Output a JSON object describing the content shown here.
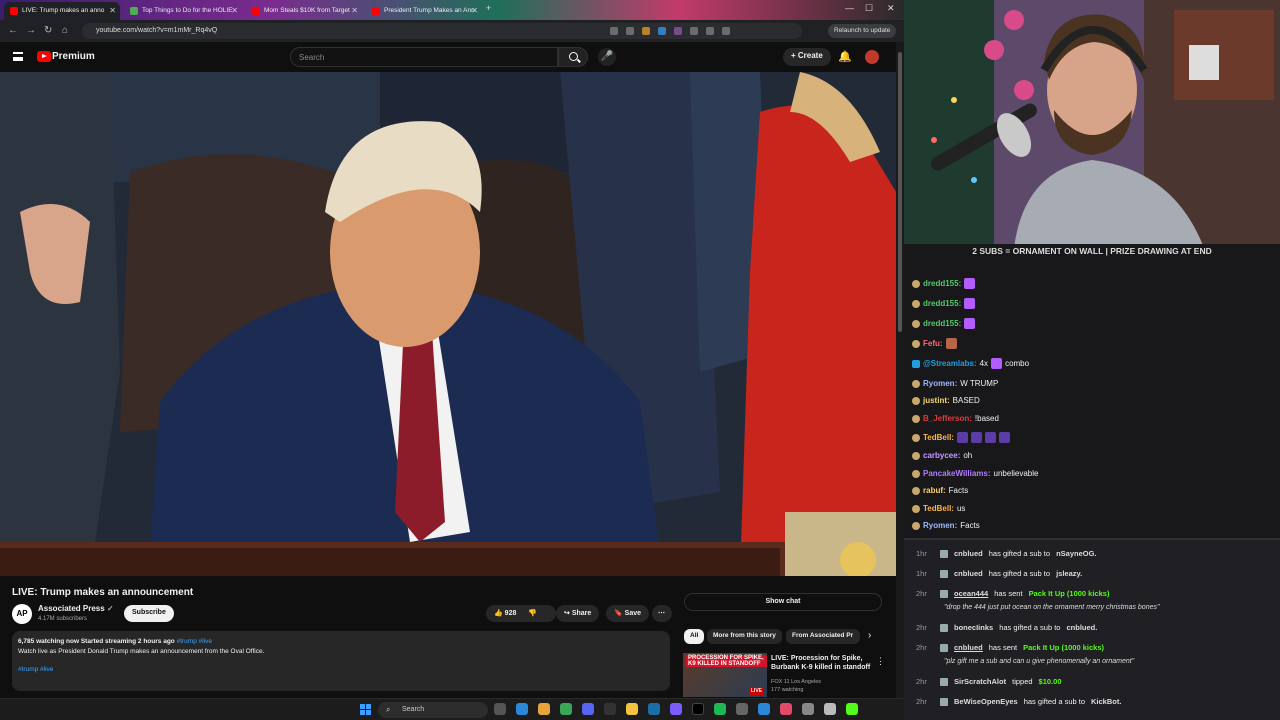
{
  "browser": {
    "tabs": [
      "LIVE: Trump makes an anno",
      "Top Things to Do for the HOLIE",
      "Mom Steals $10K from Target",
      "President Trump Makes an Ann"
    ],
    "url": "youtube.com/watch?v=m1mMr_Rq4vQ",
    "relaunch_label": "Relaunch to update"
  },
  "youtube": {
    "brand": "Premium",
    "search_placeholder": "Search",
    "create_label": "+ Create",
    "video_title": "LIVE: Trump makes an announcement",
    "channel_name": "Associated Press",
    "channel_avatar_text": "AP",
    "subscribers": "4.17M subscribers",
    "subscribe_label": "Subscribe",
    "likes": "928",
    "share_label": "Share",
    "save_label": "Save",
    "desc_stats": "6,785 watching now  Started streaming 2 hours ago",
    "desc_stats_tags": "#trump #live",
    "desc_text": "Watch live as President Donald Trump makes an announcement from the Oval Office.",
    "desc_hashtags": "#trump #live",
    "show_chat_label": "Show chat",
    "chips": [
      "All",
      "More from this story",
      "From Associated Pr"
    ],
    "side_video": {
      "thumb_text": "PROCESSION FOR SPIKE, K9 KILLED IN STANDOFF",
      "thumb_live": "LIVE",
      "title": "LIVE: Procession for Spike, Burbank K-9 killed in standoff",
      "channel": "FOX 11 Los Angeles",
      "watching": "177 watching"
    }
  },
  "taskbar": {
    "search_label": "Search"
  },
  "stream": {
    "overlay_text": "2 SUBS = ORNAMENT ON WALL | PRIZE DRAWING AT END"
  },
  "chat": [
    {
      "user": "dredd155:",
      "text": "",
      "color": "#53c96b",
      "emote": "#b35cff"
    },
    {
      "user": "dredd155:",
      "text": "",
      "color": "#53c96b",
      "emote": "#b35cff"
    },
    {
      "user": "dredd155:",
      "text": "",
      "color": "#53c96b",
      "emote": "#b35cff"
    },
    {
      "user": "Fefu:",
      "text": "",
      "color": "#ff6b6b",
      "emote": "#b5654a"
    },
    {
      "user": "@Streamlabs:",
      "text": "4x",
      "extra": "combo",
      "color": "#1fa0e0",
      "emote": "#b35cff"
    },
    {
      "user": "Ryomen:",
      "text": "W TRUMP",
      "color": "#9fb8ff"
    },
    {
      "user": "justint:",
      "text": "BASED",
      "color": "#f5d76e"
    },
    {
      "user": "B_Jefferson:",
      "text": "!based",
      "color": "#e03b3b"
    },
    {
      "user": "TedBell:",
      "text": "",
      "color": "#ffb347",
      "emote": "#5a3da8"
    },
    {
      "user": "carbycee:",
      "text": "oh",
      "color": "#c49bff"
    },
    {
      "user": "PancakeWilliams:",
      "text": "unbelievable",
      "color": "#b07cff"
    },
    {
      "user": "rabuf:",
      "text": "Facts",
      "color": "#ffd166"
    },
    {
      "user": "TedBell:",
      "text": "us",
      "color": "#ffb347"
    },
    {
      "user": "Ryomen:",
      "text": "Facts",
      "color": "#9fb8ff"
    }
  ],
  "events": [
    {
      "time": "1hr",
      "who": "cnblued",
      "text": "has gifted a sub to",
      "target": "nSayneOG."
    },
    {
      "time": "1hr",
      "who": "cnblued",
      "text": "has gifted a sub to",
      "target": "jsleazy."
    },
    {
      "time": "2hr",
      "who": "ocean444",
      "text": "has sent",
      "green": "Pack It Up (1000 kicks)",
      "quote": "\"drop the 444 just put ocean on the ornament merry christmas bones\""
    },
    {
      "time": "2hr",
      "who": "bonecIinks",
      "text": "has gifted a sub to",
      "target": "cnblued."
    },
    {
      "time": "2hr",
      "who": "cnblued",
      "text": "has sent",
      "green": "Pack It Up (1000 kicks)",
      "quote": "\"plz gift me a sub and can u give phenomenally an ornament\""
    },
    {
      "time": "2hr",
      "who": "SirScratchAlot",
      "text": "tipped",
      "green": "$10.00"
    },
    {
      "time": "2hr",
      "who": "BeWiseOpenEyes",
      "text": "has gifted a sub to",
      "target": "KickBot."
    }
  ],
  "colors": {
    "youtube_red": "#ff0000",
    "kick_green": "#53fc18",
    "link_blue": "#3ea6ff"
  }
}
